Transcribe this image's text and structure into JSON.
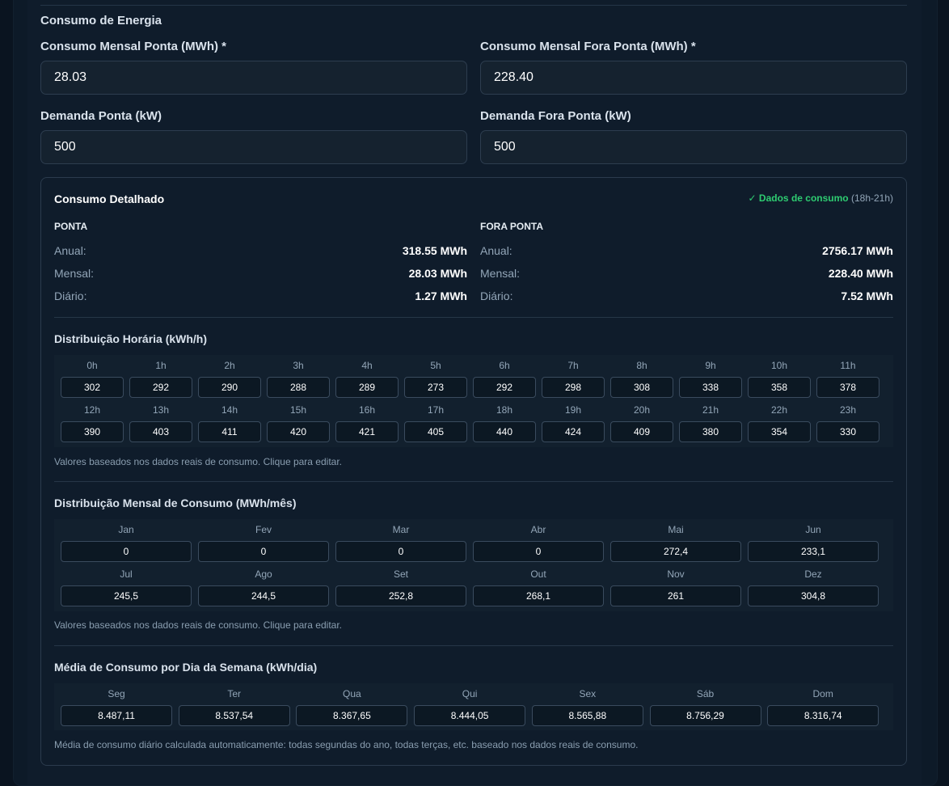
{
  "section": {
    "title": "Consumo de Energia"
  },
  "fields": [
    {
      "label": "Consumo Mensal Ponta (MWh) *",
      "value": "28.03"
    },
    {
      "label": "Consumo Mensal Fora Ponta (MWh) *",
      "value": "228.40"
    },
    {
      "label": "Demanda Ponta (kW)",
      "value": "500"
    },
    {
      "label": "Demanda Fora Ponta (kW)",
      "value": "500"
    }
  ],
  "detail": {
    "title": "Consumo Detalhado",
    "badge_ok": "✓ Dados de consumo",
    "badge_hours": "(18h-21h)",
    "ponta": {
      "title": "PONTA",
      "rows": [
        {
          "label": "Anual:",
          "value": "318.55 MWh"
        },
        {
          "label": "Mensal:",
          "value": "28.03 MWh"
        },
        {
          "label": "Diário:",
          "value": "1.27 MWh"
        }
      ]
    },
    "fora_ponta": {
      "title": "FORA PONTA",
      "rows": [
        {
          "label": "Anual:",
          "value": "2756.17 MWh"
        },
        {
          "label": "Mensal:",
          "value": "228.40 MWh"
        },
        {
          "label": "Diário:",
          "value": "7.52 MWh"
        }
      ]
    },
    "hourly": {
      "title": "Distribuição Horária (kWh/h)",
      "labels": [
        "0h",
        "1h",
        "2h",
        "3h",
        "4h",
        "5h",
        "6h",
        "7h",
        "8h",
        "9h",
        "10h",
        "11h",
        "12h",
        "13h",
        "14h",
        "15h",
        "16h",
        "17h",
        "18h",
        "19h",
        "20h",
        "21h",
        "22h",
        "23h"
      ],
      "values": [
        "302",
        "292",
        "290",
        "288",
        "289",
        "273",
        "292",
        "298",
        "308",
        "338",
        "358",
        "378",
        "390",
        "403",
        "411",
        "420",
        "421",
        "405",
        "440",
        "424",
        "409",
        "380",
        "354",
        "330"
      ],
      "note": "Valores baseados nos dados reais de consumo. Clique para editar."
    },
    "monthly": {
      "title": "Distribuição Mensal de Consumo (MWh/mês)",
      "labels": [
        "Jan",
        "Fev",
        "Mar",
        "Abr",
        "Mai",
        "Jun",
        "Jul",
        "Ago",
        "Set",
        "Out",
        "Nov",
        "Dez"
      ],
      "values": [
        "0",
        "0",
        "0",
        "0",
        "272,4",
        "233,1",
        "245,5",
        "244,5",
        "252,8",
        "268,1",
        "261",
        "304,8"
      ],
      "note": "Valores baseados nos dados reais de consumo. Clique para editar."
    },
    "weekday": {
      "title": "Média de Consumo por Dia da Semana (kWh/dia)",
      "labels": [
        "Seg",
        "Ter",
        "Qua",
        "Qui",
        "Sex",
        "Sáb",
        "Dom"
      ],
      "values": [
        "8.487,11",
        "8.537,54",
        "8.367,65",
        "8.444,05",
        "8.565,88",
        "8.756,29",
        "8.316,74"
      ],
      "note": "Média de consumo diário calculada automaticamente: todas segundas do ano, todas terças, etc. baseado nos dados reais de consumo."
    }
  }
}
